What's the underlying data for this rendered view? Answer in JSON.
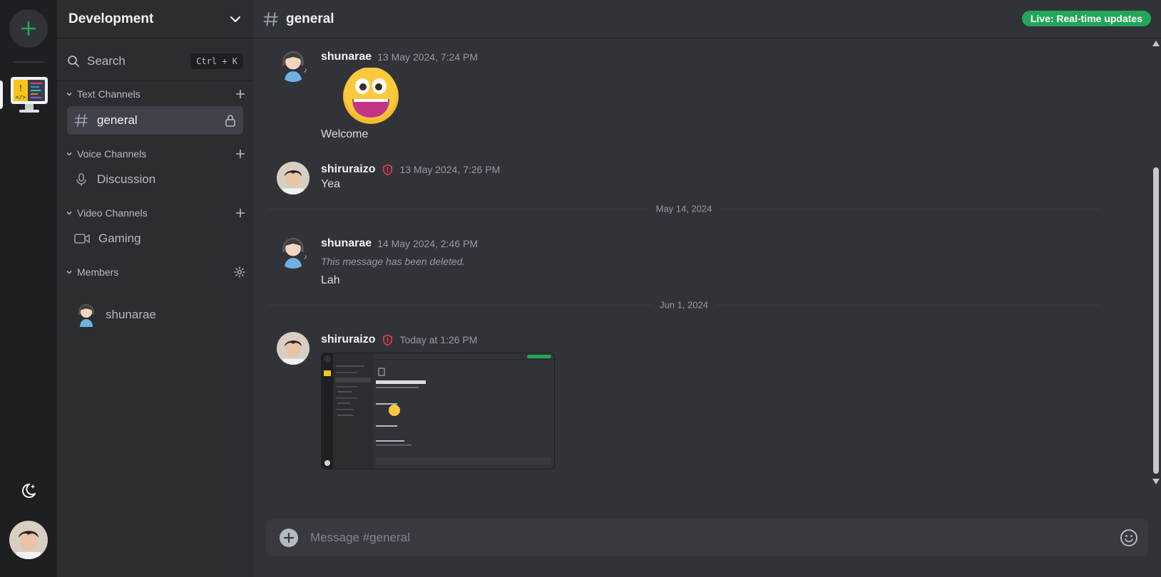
{
  "server": {
    "name": "Development",
    "add_icon": "plus-icon",
    "theme_icon": "moon-stars-icon"
  },
  "search": {
    "label": "Search",
    "shortcut": "Ctrl + K"
  },
  "categories": {
    "text": {
      "label": "Text Channels",
      "channels": [
        {
          "label": "general",
          "icon": "hash-icon",
          "locked": true,
          "active": true
        }
      ]
    },
    "voice": {
      "label": "Voice Channels",
      "channels": [
        {
          "label": "Discussion",
          "icon": "mic-icon"
        }
      ]
    },
    "video": {
      "label": "Video Channels",
      "channels": [
        {
          "label": "Gaming",
          "icon": "video-icon"
        }
      ]
    },
    "members": {
      "label": "Members",
      "items": [
        {
          "name": "shunarae"
        }
      ]
    }
  },
  "channel": {
    "title": "general",
    "live_label": "Live: Real-time updates"
  },
  "messages": [
    {
      "author": "shunarae",
      "timestamp": "13 May 2024, 7:24 PM",
      "text": "Welcome",
      "emoji": "grinning-face"
    },
    {
      "author": "shiruraizo",
      "timestamp": "13 May 2024, 7:26 PM",
      "text": "Yea",
      "moderator": true
    },
    {
      "author": "shunarae",
      "timestamp": "14 May 2024, 2:46 PM",
      "deleted_text": "This message has been deleted.",
      "text": "Lah"
    },
    {
      "author": "shiruraizo",
      "timestamp": "Today at 1:26 PM",
      "moderator": true,
      "attachment": "screenshot"
    }
  ],
  "dividers": [
    "May 14, 2024",
    "Jun 1, 2024"
  ],
  "composer": {
    "placeholder": "Message #general"
  },
  "colors": {
    "accent_green": "#23a55a",
    "moderator_red": "#f23f43"
  }
}
